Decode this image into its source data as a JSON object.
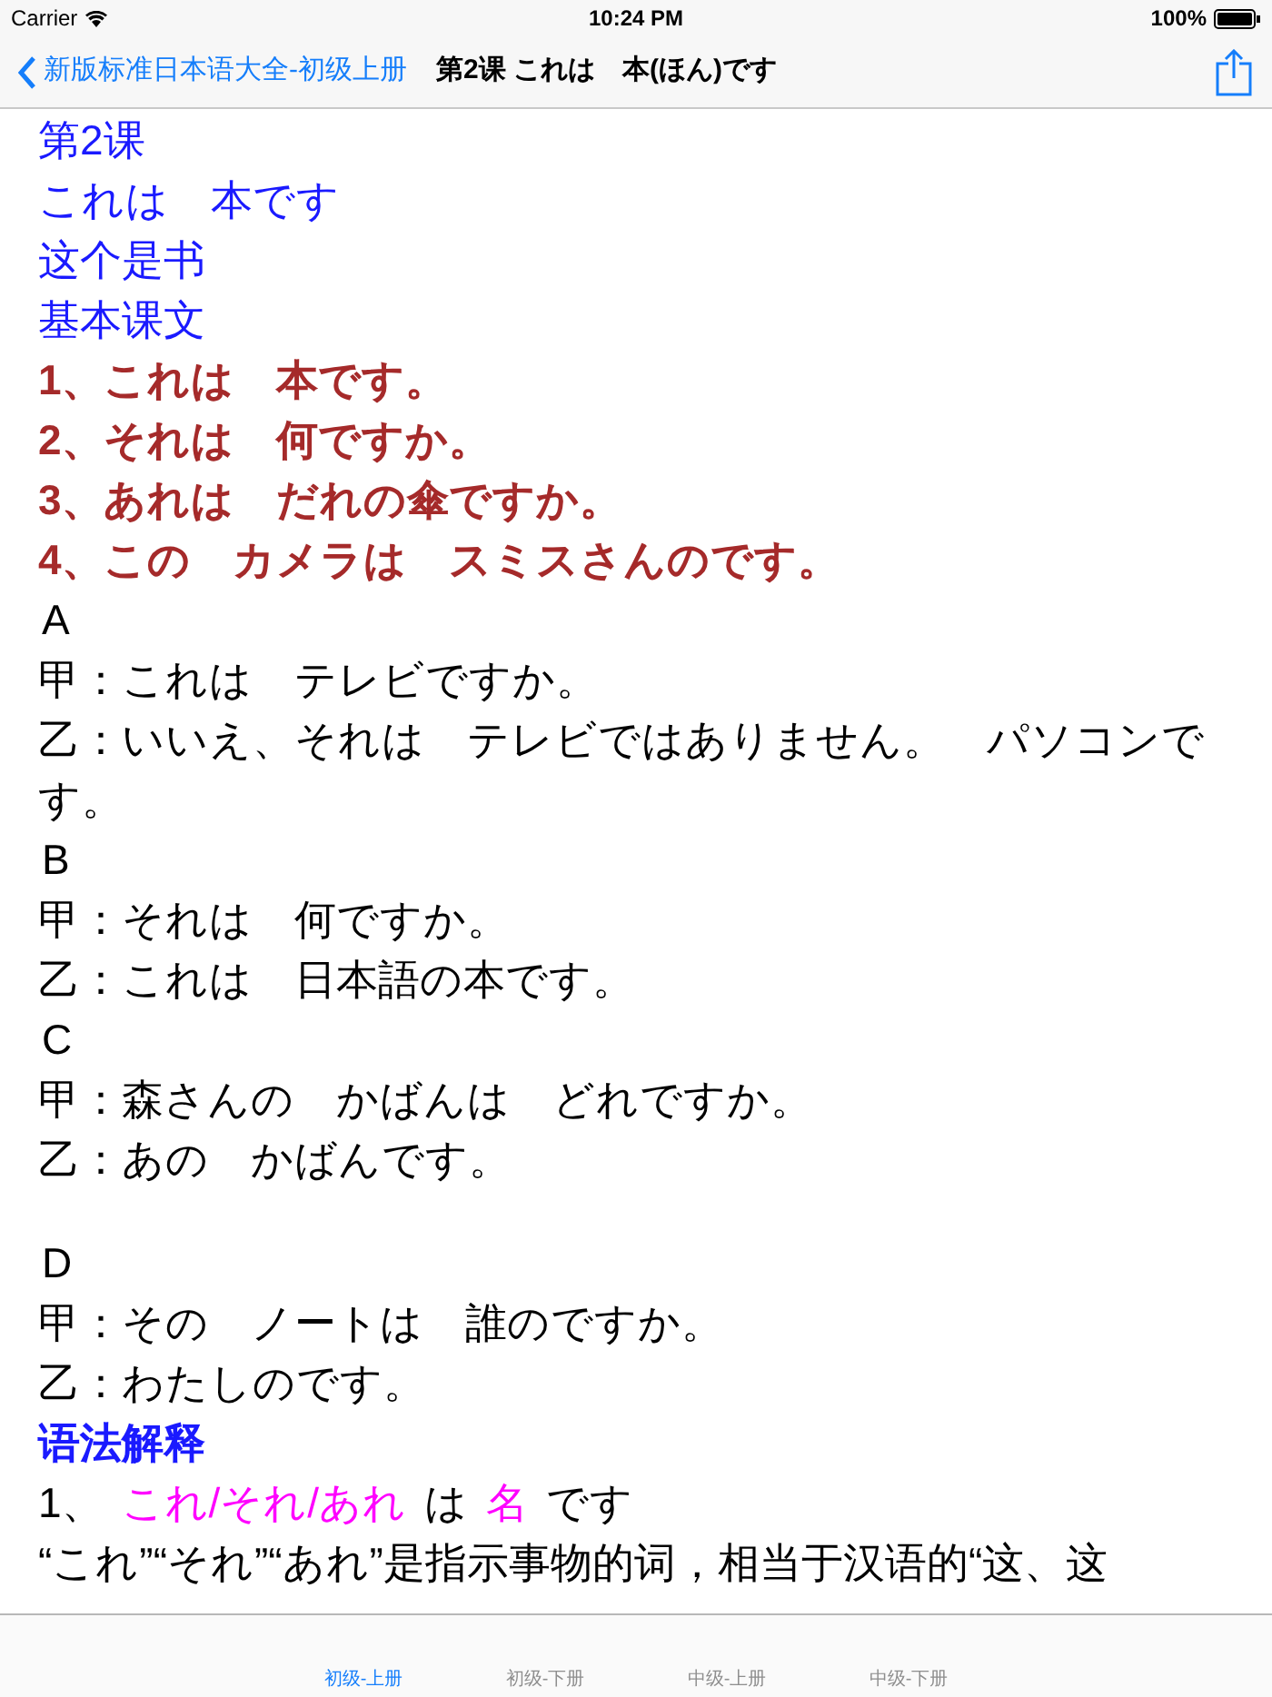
{
  "status_bar": {
    "carrier": "Carrier",
    "time": "10:24 PM",
    "battery": "100%"
  },
  "nav_bar": {
    "back": "新版标准日本语大全-初级上册",
    "title": "第2课 これは　本(ほん)です"
  },
  "lines": [
    {
      "kind": "title",
      "text": "第2课"
    },
    {
      "kind": "title",
      "text": "これは　本です"
    },
    {
      "kind": "title",
      "text": "这个是书"
    },
    {
      "kind": "title",
      "text": "基本课文"
    },
    {
      "kind": "sentence",
      "text": "1、これは　本です。"
    },
    {
      "kind": "sentence",
      "text": "2、それは　何ですか。"
    },
    {
      "kind": "sentence",
      "text": "3、あれは　だれの傘ですか。"
    },
    {
      "kind": "sentence",
      "text": "4、この　カメラは　スミスさんのです。"
    },
    {
      "kind": "label",
      "text": "A"
    },
    {
      "kind": "plain",
      "text": "甲：これは　テレビですか。"
    },
    {
      "kind": "plain",
      "text": "乙：いいえ、それは　テレビではありません。　パソコンです。"
    },
    {
      "kind": "label",
      "text": "B"
    },
    {
      "kind": "plain",
      "text": "甲：それは　何ですか。"
    },
    {
      "kind": "plain",
      "text": "乙：これは　日本語の本です。"
    },
    {
      "kind": "label",
      "text": "C"
    },
    {
      "kind": "plain",
      "text": "甲：森さんの　かばんは　どれですか。"
    },
    {
      "kind": "plain",
      "text": "乙：あの　かばんです。"
    },
    {
      "kind": "label",
      "text": "D",
      "gap_before": true
    },
    {
      "kind": "plain",
      "text": "甲：その　ノートは　誰のですか。"
    },
    {
      "kind": "plain",
      "text": "乙：わたしのです。"
    },
    {
      "kind": "section",
      "text": "语法解释"
    },
    {
      "kind": "pattern",
      "parts": [
        {
          "text": "1、",
          "highlight": false
        },
        {
          "text": "これ/それ/あれ",
          "highlight": true
        },
        {
          "text": "は",
          "highlight": false
        },
        {
          "text": "名",
          "highlight": true
        },
        {
          "text": "です",
          "highlight": false
        }
      ]
    },
    {
      "kind": "plain",
      "text": "“これ”“それ”“あれ”是指示事物的词，相当于汉语的“这、这"
    }
  ],
  "tab_bar": [
    {
      "label": "初级-上册",
      "selected": true
    },
    {
      "label": "初级-下册",
      "selected": false
    },
    {
      "label": "中级-上册",
      "selected": false
    },
    {
      "label": "中级-下册",
      "selected": false
    }
  ]
}
